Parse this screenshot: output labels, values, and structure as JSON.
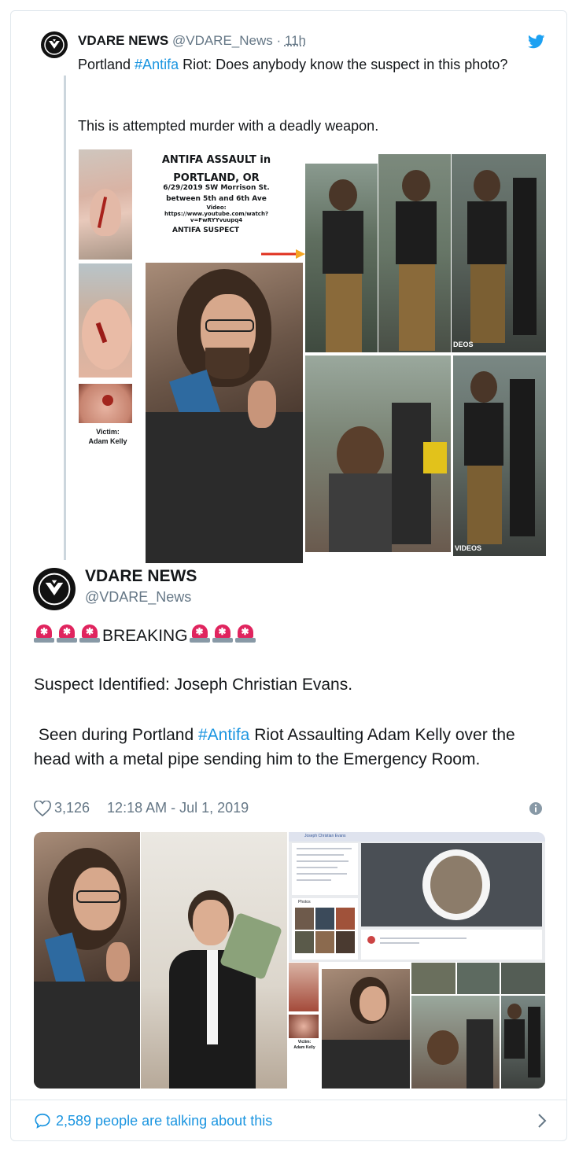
{
  "quoted_tweet": {
    "display_name": "VDARE NEWS",
    "handle": "@VDARE_News",
    "separator": "·",
    "time": "11h",
    "text_before_hashtag": "Portland ",
    "hashtag": "#Antifa",
    "text_after_hashtag": " Riot: Does anybody know the suspect in this photo?",
    "text_line2": "This is attempted murder with a deadly weapon.",
    "collage": {
      "title_line1": "ANTIFA ASSAULT in",
      "title_line2": "PORTLAND, OR",
      "date_location": "6/29/2019 SW Morrison St.",
      "between": "between 5th and 6th Ave",
      "video_label": "Video:",
      "video_url_line1": "https://www.youtube.com/watch?",
      "video_url_line2": "v=FwRYYvuupq4",
      "suspect_label": "ANTIFA SUSPECT",
      "victim_label": "Victim:",
      "victim_name": "Adam Kelly",
      "videos_label_1": "DEOS",
      "videos_label_2": "VIDEOS"
    }
  },
  "main_tweet": {
    "display_name": "VDARE NEWS",
    "handle": "@VDARE_News",
    "breaking": "BREAKING",
    "line_identified": "Suspect Identified: Joseph Christian Evans.",
    "text_seen_before": " Seen during Portland ",
    "hashtag": "#Antifa",
    "text_seen_after": " Riot Assaulting Adam Kelly over the head with a metal pipe sending him to the Emergency Room.",
    "likes": "3,126",
    "timestamp": "12:18 AM - Jul 1, 2019",
    "image": {
      "profile_name": "Joseph Christian Evans",
      "photos_label": "Photos",
      "victim_label": "Victim:",
      "victim_name": "Adam Kelly"
    }
  },
  "footer": {
    "talking": "2,589 people are talking about this"
  },
  "colors": {
    "link": "#1b95e0",
    "twitter_blue": "#1da1f2",
    "siren_red": "#e0245e",
    "muted": "#657786",
    "border": "#e1e8ed"
  },
  "icons": [
    "twitter-bird-icon",
    "siren-icon",
    "heart-icon",
    "info-icon",
    "reply-bubble-icon",
    "chevron-right-icon",
    "avatar-logo-icon"
  ]
}
